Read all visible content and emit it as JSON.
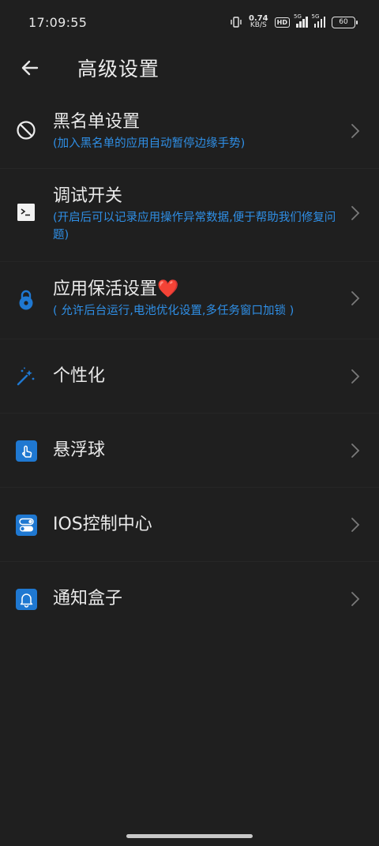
{
  "status": {
    "time": "17:09:55",
    "net_speed_value": "0.74",
    "net_speed_unit": "KB/S",
    "hd_badge": "HD",
    "signal_1_label": "5G",
    "signal_2_label": "5G",
    "battery": "60"
  },
  "header": {
    "title": "高级设置"
  },
  "items": [
    {
      "title": "黑名单设置",
      "subtitle": "(加入黑名单的应用自动暂停边缘手势)",
      "icon": "block-icon"
    },
    {
      "title": "调试开关",
      "subtitle": "(开启后可以记录应用操作异常数据,便于帮助我们修复问题)",
      "icon": "terminal-icon"
    },
    {
      "title": "应用保活设置❤️",
      "subtitle": "( 允许后台运行,电池优化设置,多任务窗口加锁 )",
      "icon": "lock-icon"
    },
    {
      "title": "个性化",
      "subtitle": "",
      "icon": "magic-wand-icon"
    },
    {
      "title": "悬浮球",
      "subtitle": "",
      "icon": "touch-icon"
    },
    {
      "title": "IOS控制中心",
      "subtitle": "",
      "icon": "toggle-icon"
    },
    {
      "title": "通知盒子",
      "subtitle": "",
      "icon": "bell-icon"
    }
  ],
  "colors": {
    "background": "#1f1f1f",
    "accent": "#2f8fe6",
    "icon_blue": "#1f78d1",
    "text": "#e9e9e9"
  }
}
